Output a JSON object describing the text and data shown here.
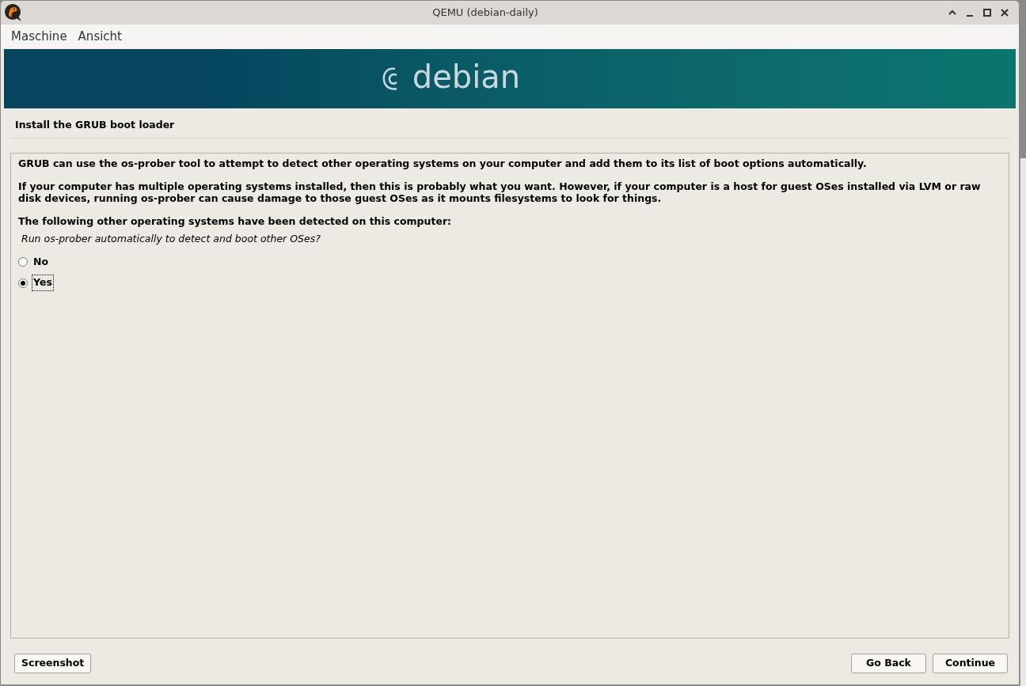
{
  "window": {
    "title": "QEMU (debian-daily)"
  },
  "menu": [
    "Maschine",
    "Ansicht"
  ],
  "banner": {
    "logo_text": "debian"
  },
  "installer": {
    "step_title": "Install the GRUB boot loader",
    "paragraphs": [
      {
        "kind": "text",
        "text": "GRUB can use the os-prober tool to attempt to detect other operating systems on your computer and add them to its list of boot options automatically."
      },
      {
        "kind": "text",
        "text": "If your computer has multiple operating systems installed, then this is probably what you want. However, if your computer is a host for guest OSes installed via LVM or raw disk devices, running os-prober can cause damage to those guest OSes as it mounts filesystems to look for things."
      },
      {
        "kind": "text",
        "text": "The following other operating systems have been detected on this computer:"
      },
      {
        "kind": "question",
        "text": "Run os-prober automatically to detect and boot other OSes?"
      }
    ],
    "options": [
      {
        "label": "No",
        "selected": false,
        "focused": false
      },
      {
        "label": "Yes",
        "selected": true,
        "focused": true
      }
    ],
    "buttons": {
      "left": [
        "Screenshot"
      ],
      "right": [
        "Go Back",
        "Continue"
      ]
    }
  }
}
